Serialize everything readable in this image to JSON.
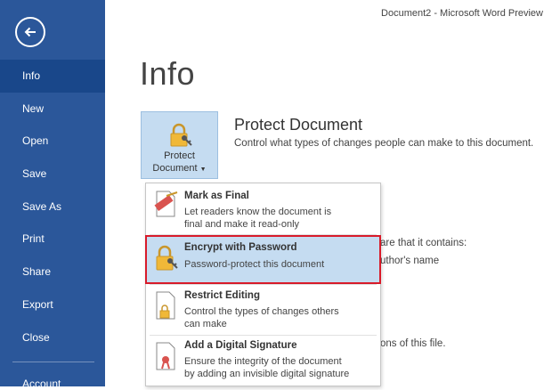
{
  "window": {
    "title": "Document2 - Microsoft Word Preview"
  },
  "sidebar": {
    "back_label": "Back",
    "items": [
      {
        "label": "Info",
        "active": true
      },
      {
        "label": "New"
      },
      {
        "label": "Open"
      },
      {
        "label": "Save"
      },
      {
        "label": "Save As"
      },
      {
        "label": "Print"
      },
      {
        "label": "Share"
      },
      {
        "label": "Export"
      },
      {
        "label": "Close"
      }
    ],
    "cut_item": "Account"
  },
  "main": {
    "heading": "Info",
    "protect_button": {
      "line1": "Protect",
      "line2": "Document"
    },
    "section_title": "Protect Document",
    "section_desc": "Control what types of changes people can make to this document.",
    "bg_line1": "are that it contains:",
    "bg_line2": "uthor's name",
    "bg_line3": "ons of this file."
  },
  "dropdown": {
    "items": [
      {
        "title": "Mark as Final",
        "desc1": "Let readers know the document is",
        "desc2": "final and make it read-only"
      },
      {
        "title": "Encrypt with Password",
        "desc1": "Password-protect this document",
        "highlighted": true
      },
      {
        "title": "Restrict Editing",
        "desc1": "Control the types of changes others",
        "desc2": "can make"
      },
      {
        "title": "Add a Digital Signature",
        "desc1": "Ensure the integrity of the document",
        "desc2": "by adding an invisible digital signature"
      }
    ]
  },
  "colors": {
    "sidebar": "#2b579a",
    "sidebar_active": "#19478a",
    "highlight": "#c5dcf1",
    "highlight_border": "#d81b2a"
  }
}
